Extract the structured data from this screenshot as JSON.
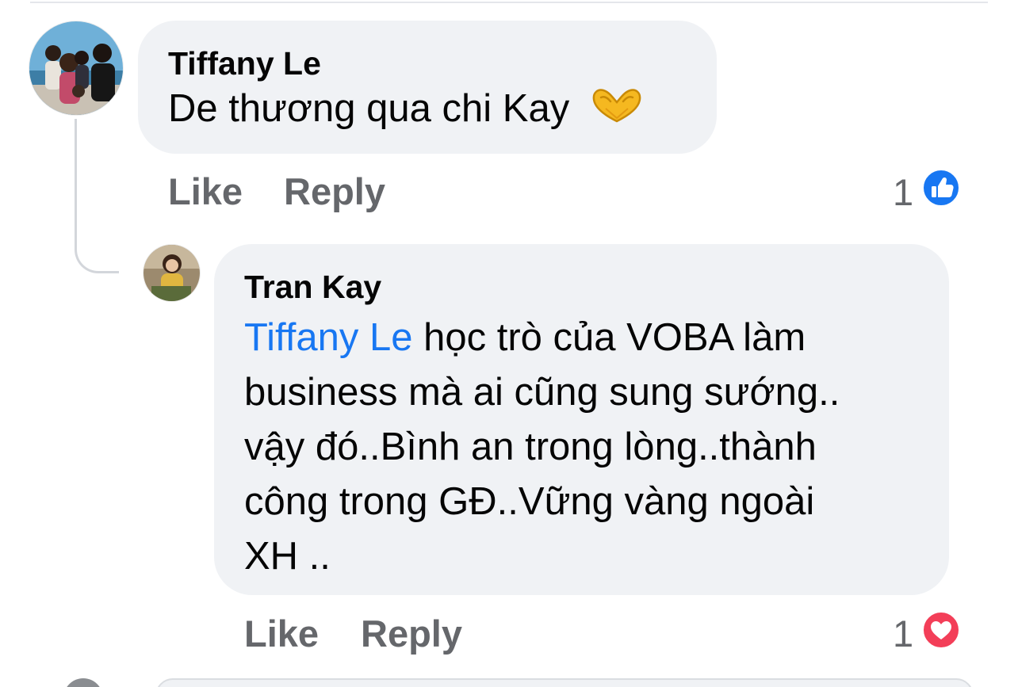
{
  "comments": [
    {
      "author": "Tiffany Le",
      "text": "De thương qua chi Kay",
      "emoji": "heart-hands-emoji",
      "actions": {
        "like": "Like",
        "reply": "Reply"
      },
      "reaction": {
        "count": "1",
        "type": "like-reaction-icon",
        "color": "#1877f2"
      }
    },
    {
      "author": "Tran Kay",
      "mention": "Tiffany Le",
      "lines": [
        " học trò của VOBA làm",
        "business mà ai cũng sung sướng..",
        "vậy đó..Bình an trong lòng..thành",
        "công trong GĐ..Vững vàng ngoài",
        "XH .."
      ],
      "actions": {
        "like": "Like",
        "reply": "Reply"
      },
      "reaction": {
        "count": "1",
        "type": "love-reaction-icon",
        "color": "#f33e58"
      }
    }
  ]
}
